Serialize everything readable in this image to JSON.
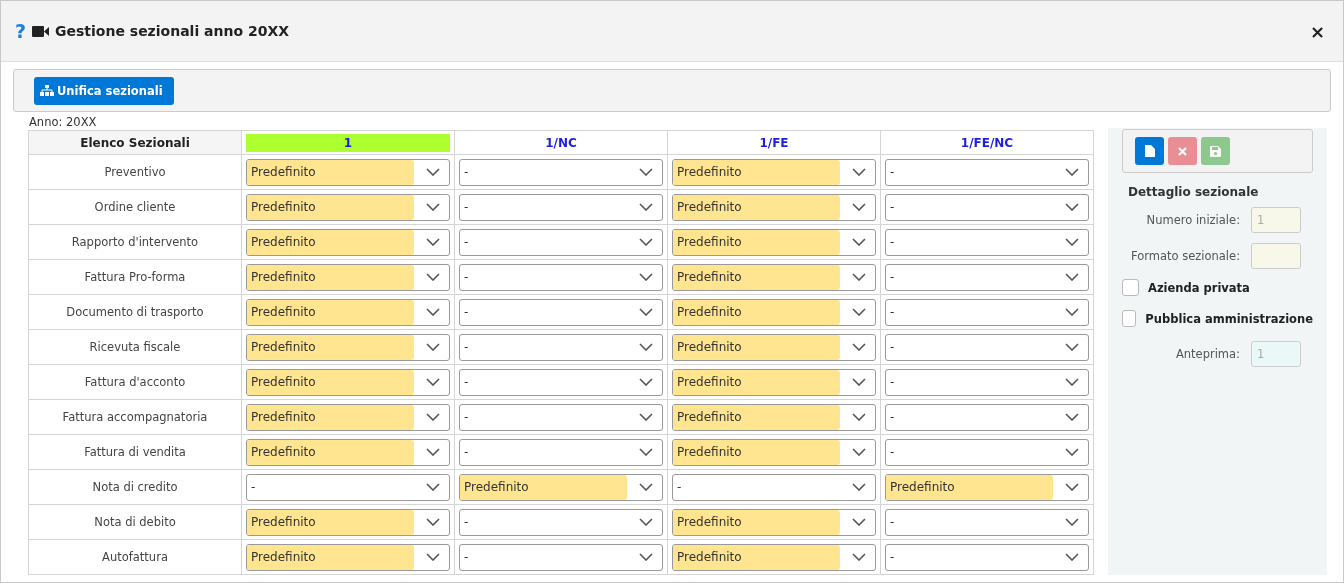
{
  "window": {
    "help": "?",
    "title": "Gestione sezionali anno 20XX",
    "close": "×"
  },
  "toolbar": {
    "button": "Unifica sezionali"
  },
  "year_label": "Anno: 20XX",
  "table": {
    "corner": "Elenco Sezionali",
    "columns": [
      {
        "label": "1",
        "selected": true
      },
      {
        "label": "1/NC",
        "selected": false
      },
      {
        "label": "1/FE",
        "selected": false
      },
      {
        "label": "1/FE/NC",
        "selected": false
      }
    ],
    "rows": [
      {
        "label": "Preventivo",
        "cells": [
          {
            "value": "Predefinito",
            "highlighted": true
          },
          {
            "value": "-",
            "highlighted": false
          },
          {
            "value": "Predefinito",
            "highlighted": true
          },
          {
            "value": "-",
            "highlighted": false
          }
        ]
      },
      {
        "label": "Ordine cliente",
        "cells": [
          {
            "value": "Predefinito",
            "highlighted": true
          },
          {
            "value": "-",
            "highlighted": false
          },
          {
            "value": "Predefinito",
            "highlighted": true
          },
          {
            "value": "-",
            "highlighted": false
          }
        ]
      },
      {
        "label": "Rapporto d'intervento",
        "cells": [
          {
            "value": "Predefinito",
            "highlighted": true
          },
          {
            "value": "-",
            "highlighted": false
          },
          {
            "value": "Predefinito",
            "highlighted": true
          },
          {
            "value": "-",
            "highlighted": false
          }
        ]
      },
      {
        "label": "Fattura Pro-forma",
        "cells": [
          {
            "value": "Predefinito",
            "highlighted": true
          },
          {
            "value": "-",
            "highlighted": false
          },
          {
            "value": "Predefinito",
            "highlighted": true
          },
          {
            "value": "-",
            "highlighted": false
          }
        ]
      },
      {
        "label": "Documento di trasporto",
        "cells": [
          {
            "value": "Predefinito",
            "highlighted": true
          },
          {
            "value": "-",
            "highlighted": false
          },
          {
            "value": "Predefinito",
            "highlighted": true
          },
          {
            "value": "-",
            "highlighted": false
          }
        ]
      },
      {
        "label": "Ricevuta fiscale",
        "cells": [
          {
            "value": "Predefinito",
            "highlighted": true
          },
          {
            "value": "-",
            "highlighted": false
          },
          {
            "value": "Predefinito",
            "highlighted": true
          },
          {
            "value": "-",
            "highlighted": false
          }
        ]
      },
      {
        "label": "Fattura d'acconto",
        "cells": [
          {
            "value": "Predefinito",
            "highlighted": true
          },
          {
            "value": "-",
            "highlighted": false
          },
          {
            "value": "Predefinito",
            "highlighted": true
          },
          {
            "value": "-",
            "highlighted": false
          }
        ]
      },
      {
        "label": "Fattura accompagnatoria",
        "cells": [
          {
            "value": "Predefinito",
            "highlighted": true
          },
          {
            "value": "-",
            "highlighted": false
          },
          {
            "value": "Predefinito",
            "highlighted": true
          },
          {
            "value": "-",
            "highlighted": false
          }
        ]
      },
      {
        "label": "Fattura di vendita",
        "cells": [
          {
            "value": "Predefinito",
            "highlighted": true
          },
          {
            "value": "-",
            "highlighted": false
          },
          {
            "value": "Predefinito",
            "highlighted": true
          },
          {
            "value": "-",
            "highlighted": false
          }
        ]
      },
      {
        "label": "Nota di credito",
        "cells": [
          {
            "value": "-",
            "highlighted": false
          },
          {
            "value": "Predefinito",
            "highlighted": true
          },
          {
            "value": "-",
            "highlighted": false
          },
          {
            "value": "Predefinito",
            "highlighted": true
          }
        ]
      },
      {
        "label": "Nota di debito",
        "cells": [
          {
            "value": "Predefinito",
            "highlighted": true
          },
          {
            "value": "-",
            "highlighted": false
          },
          {
            "value": "Predefinito",
            "highlighted": true
          },
          {
            "value": "-",
            "highlighted": false
          }
        ]
      },
      {
        "label": "Autofattura",
        "cells": [
          {
            "value": "Predefinito",
            "highlighted": true
          },
          {
            "value": "-",
            "highlighted": false
          },
          {
            "value": "Predefinito",
            "highlighted": true
          },
          {
            "value": "-",
            "highlighted": false
          }
        ]
      }
    ]
  },
  "detail": {
    "title": "Dettaglio sezionale",
    "buttons": [
      {
        "kind": "new",
        "disabled": false
      },
      {
        "kind": "delete",
        "disabled": true
      },
      {
        "kind": "save",
        "disabled": true
      }
    ],
    "fields": [
      {
        "label": "Numero iniziale:",
        "placeholder": "1"
      },
      {
        "label": "Formato sezionale:"
      }
    ],
    "checkboxes": [
      {
        "label": "Azienda privata",
        "checked": false
      },
      {
        "label": "Pubblica amministrazione",
        "checked": false
      }
    ],
    "preview": {
      "label": "Anteprima:",
      "placeholder": "1"
    }
  }
}
